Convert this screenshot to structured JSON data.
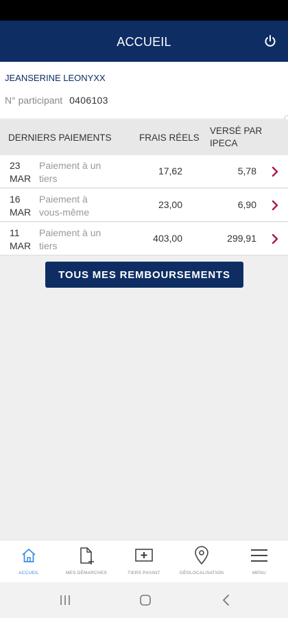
{
  "header": {
    "title": "ACCUEIL"
  },
  "user": {
    "name": "JEANSERINE LEONYXX",
    "participant_label": "N° participant",
    "participant_number": "0406103"
  },
  "table": {
    "headers": {
      "last_payments": "DERNIERS PAIEMENTS",
      "frais": "FRAIS RÉELS",
      "verse_line1": "VERSÉ PAR",
      "verse_line2": "IPECA"
    },
    "rows": [
      {
        "day": "23",
        "month": "MAR",
        "desc_line1": "Paiement à un",
        "desc_line2": "tiers",
        "frais": "17,62",
        "verse": "5,78"
      },
      {
        "day": "16",
        "month": "MAR",
        "desc_line1": "Paiement à",
        "desc_line2": "vous-même",
        "frais": "23,00",
        "verse": "6,90"
      },
      {
        "day": "11",
        "month": "MAR",
        "desc_line1": "Paiement à un",
        "desc_line2": "tiers",
        "frais": "403,00",
        "verse": "299,91"
      }
    ]
  },
  "cta": {
    "label": "TOUS MES REMBOURSEMENTS"
  },
  "bottom_nav": {
    "items": [
      {
        "label": "ACCUEIL",
        "icon": "home-icon",
        "active": true
      },
      {
        "label": "MES DÉMARCHES",
        "icon": "document-add-icon",
        "active": false
      },
      {
        "label": "TIERS PAYANT",
        "icon": "medical-card-icon",
        "active": false
      },
      {
        "label": "GÉOLOCALISATION",
        "icon": "location-pin-icon",
        "active": false
      },
      {
        "label": "MENU",
        "icon": "hamburger-menu-icon",
        "active": false
      }
    ]
  },
  "colors": {
    "brand_navy": "#0e2d63",
    "active_blue": "#3a8ee6",
    "chevron": "#b0134f"
  }
}
